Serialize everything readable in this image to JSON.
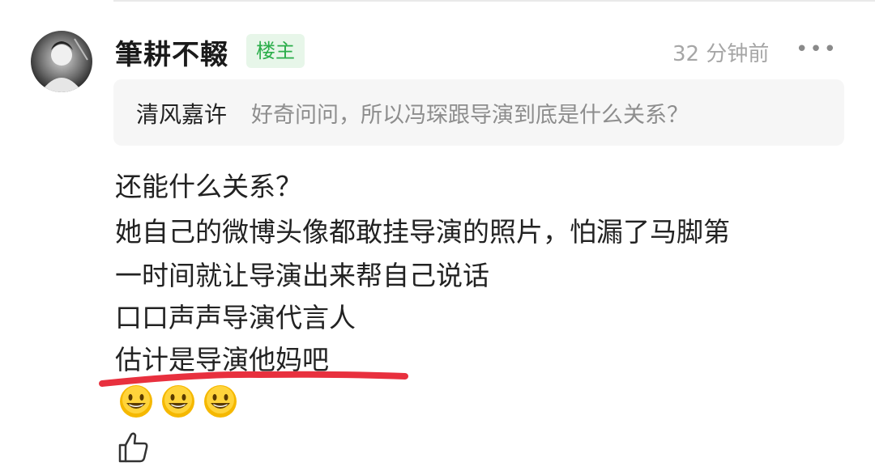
{
  "comment": {
    "username": "筆耕不輟",
    "badge": "楼主",
    "timestamp": "32 分钟前",
    "more_label": "•••",
    "quote": {
      "author": "清风嘉许",
      "text": "好奇问问，所以冯琛跟导演到底是什么关系？"
    },
    "lines": [
      "还能什么关系？",
      "她自己的微博头像都敢挂导演的照片，怕漏了马脚第",
      "一时间就让导演出来帮自己说话",
      "口口声声导演代言人",
      "估计是导演他妈吧"
    ],
    "emojis": [
      "grinning-face",
      "grinning-face",
      "grinning-face"
    ]
  },
  "icons": {
    "avatar": "avatar-photo",
    "like": "thumbs-up-icon",
    "more": "more-dots-icon"
  },
  "colors": {
    "badge_text": "#2bae4a",
    "badge_bg": "#e7f6e9",
    "underline": "#e8303e",
    "quote_bg": "#f6f6f6",
    "emoji_yellow": "#f5b800"
  }
}
